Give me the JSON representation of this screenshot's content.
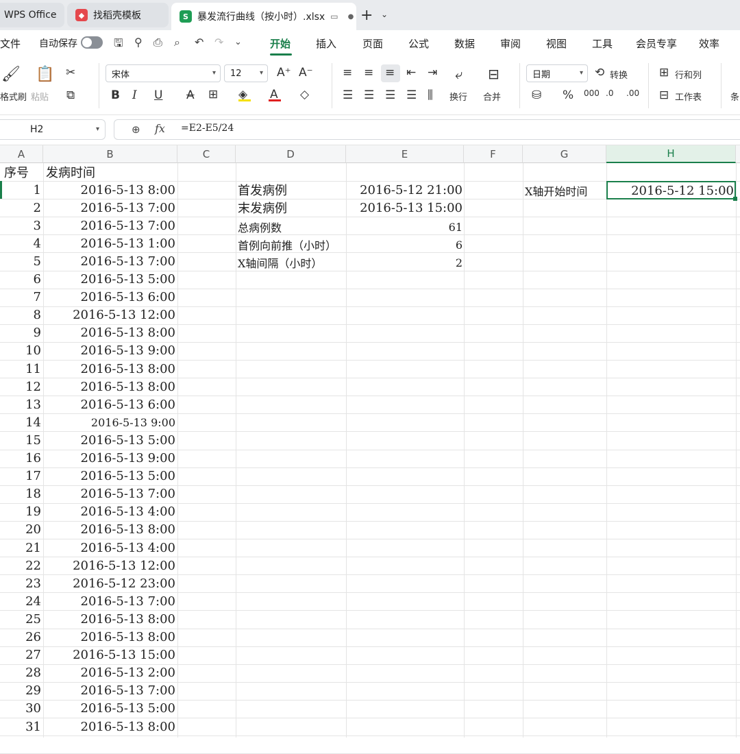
{
  "tabs": [
    {
      "label": "WPS Office"
    },
    {
      "label": "找稻壳模板"
    },
    {
      "label": "暴发流行曲线（按小时）.xlsx"
    }
  ],
  "menu": {
    "file": "文件",
    "autosave": "自动保存",
    "items": [
      "开始",
      "插入",
      "页面",
      "公式",
      "数据",
      "审阅",
      "视图",
      "工具",
      "会员专享",
      "效率"
    ]
  },
  "ribbon": {
    "format_painter": "格式刷",
    "paste": "粘贴",
    "font_name": "宋体",
    "font_size": "12",
    "wrap": "换行",
    "merge": "合并",
    "number_format": "日期",
    "convert": "转换",
    "row_col": "行和列",
    "worksheet": "工作表",
    "cond": "条",
    "colors": {
      "highlight": "#f5e000",
      "font": "#e02020"
    }
  },
  "formula_bar": {
    "cell_ref": "H2",
    "formula": "=E2-E5/24"
  },
  "columns": [
    "A",
    "B",
    "C",
    "D",
    "E",
    "F",
    "G",
    "H"
  ],
  "headers": {
    "seq": "序号",
    "onset": "发病时间"
  },
  "rows": [
    {
      "n": "1",
      "t": "2016-5-13 8:00"
    },
    {
      "n": "2",
      "t": "2016-5-13 7:00"
    },
    {
      "n": "3",
      "t": "2016-5-13 7:00"
    },
    {
      "n": "4",
      "t": "2016-5-13 1:00"
    },
    {
      "n": "5",
      "t": "2016-5-13 7:00"
    },
    {
      "n": "6",
      "t": "2016-5-13 5:00"
    },
    {
      "n": "7",
      "t": "2016-5-13 6:00"
    },
    {
      "n": "8",
      "t": "2016-5-13 12:00"
    },
    {
      "n": "9",
      "t": "2016-5-13 8:00"
    },
    {
      "n": "10",
      "t": "2016-5-13 9:00"
    },
    {
      "n": "11",
      "t": "2016-5-13 8:00"
    },
    {
      "n": "12",
      "t": "2016-5-13 8:00"
    },
    {
      "n": "13",
      "t": "2016-5-13 6:00"
    },
    {
      "n": "14",
      "t": "2016-5-13 9:00"
    },
    {
      "n": "15",
      "t": "2016-5-13 5:00"
    },
    {
      "n": "16",
      "t": "2016-5-13 9:00"
    },
    {
      "n": "17",
      "t": "2016-5-13 5:00"
    },
    {
      "n": "18",
      "t": "2016-5-13 7:00"
    },
    {
      "n": "19",
      "t": "2016-5-13 4:00"
    },
    {
      "n": "20",
      "t": "2016-5-13 8:00"
    },
    {
      "n": "21",
      "t": "2016-5-13 4:00"
    },
    {
      "n": "22",
      "t": "2016-5-13 12:00"
    },
    {
      "n": "23",
      "t": "2016-5-12 23:00"
    },
    {
      "n": "24",
      "t": "2016-5-13 7:00"
    },
    {
      "n": "25",
      "t": "2016-5-13 8:00"
    },
    {
      "n": "26",
      "t": "2016-5-13 8:00"
    },
    {
      "n": "27",
      "t": "2016-5-13 15:00"
    },
    {
      "n": "28",
      "t": "2016-5-13 2:00"
    },
    {
      "n": "29",
      "t": "2016-5-13 7:00"
    },
    {
      "n": "30",
      "t": "2016-5-13 5:00"
    },
    {
      "n": "31",
      "t": "2016-5-13 8:00"
    }
  ],
  "summary": [
    {
      "label": "首发病例",
      "value": "2016-5-12 21:00"
    },
    {
      "label": "末发病例",
      "value": "2016-5-13 15:00"
    },
    {
      "label": "总病例数",
      "value": "61"
    },
    {
      "label": "首例向前推（小时）",
      "value": "6"
    },
    {
      "label": "X轴间隔（小时）",
      "value": "2"
    }
  ],
  "xaxis": {
    "label": "X轴开始时间",
    "value": "2016-5-12 15:00"
  }
}
